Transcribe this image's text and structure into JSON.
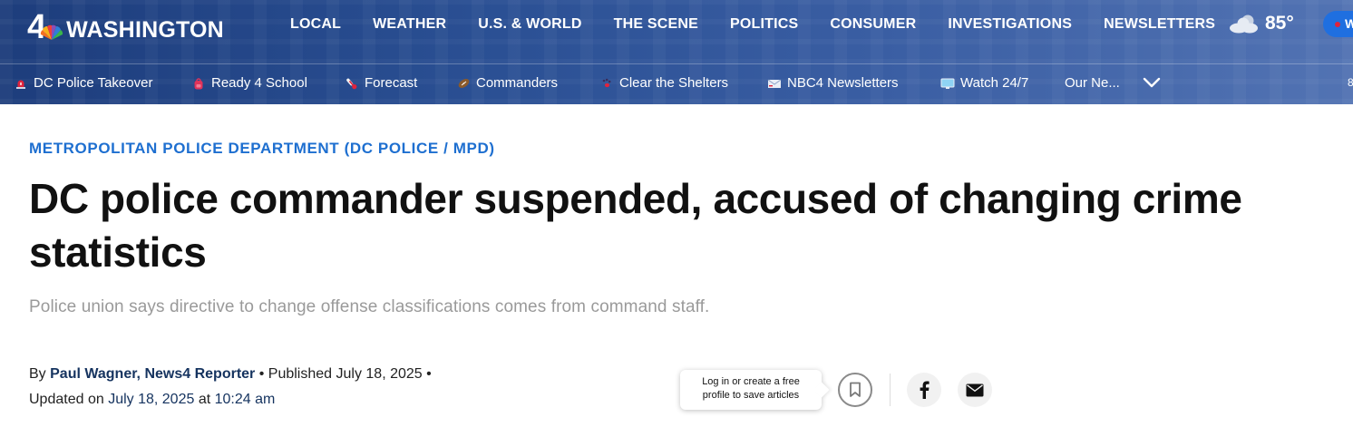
{
  "header": {
    "logo_number": "4",
    "logo_text": "WASHINGTON",
    "nav": [
      "LOCAL",
      "WEATHER",
      "U.S. & WORLD",
      "THE SCENE",
      "POLITICS",
      "CONSUMER",
      "INVESTIGATIONS",
      "NEWSLETTERS"
    ],
    "weather": {
      "icon": "cloud-icon",
      "temp": "85°"
    },
    "watch_label": "W",
    "colors": {
      "masthead": "#2a4f93",
      "watch_pill": "#1f6fe0",
      "live_dot": "#e0233c"
    }
  },
  "trending": {
    "items": [
      {
        "label": "DC Police Takeover",
        "icon": "siren-icon"
      },
      {
        "label": "Ready 4 School",
        "icon": "backpack-icon"
      },
      {
        "label": "Forecast",
        "icon": "thermometer-icon"
      },
      {
        "label": "Commanders",
        "icon": "football-icon"
      },
      {
        "label": "Clear the Shelters",
        "icon": "paw-icon"
      },
      {
        "label": "NBC4 Newsletters",
        "icon": "envelope-icon"
      },
      {
        "label": "Watch 24/7",
        "icon": "tv-icon"
      },
      {
        "label": "Our Ne...",
        "icon": ""
      }
    ],
    "more_icon": "chevron-down-icon"
  },
  "article": {
    "kicker": "METROPOLITAN POLICE DEPARTMENT (DC POLICE / MPD)",
    "headline": "DC police commander suspended, accused of changing crime statistics",
    "dek": "Police union says directive to change offense classifications comes from command staff.",
    "byline": {
      "by": "By",
      "author": "Paul Wagner, News4 Reporter",
      "published_prefix": "• Published",
      "published_date": "July 18, 2025",
      "bullet": "•",
      "updated_prefix": "Updated on",
      "updated_date": "July 18, 2025",
      "at": "at",
      "updated_time": "10:24 am"
    },
    "colors": {
      "kicker": "#1e6fd0",
      "author": "#15335f",
      "dek": "#9a9a9a"
    }
  },
  "save": {
    "tooltip_line1": "Log in or create a free",
    "tooltip_line2": "profile to save articles",
    "icon": "bookmark-icon"
  },
  "share": {
    "facebook_icon": "facebook-icon",
    "email_icon": "email-icon"
  }
}
